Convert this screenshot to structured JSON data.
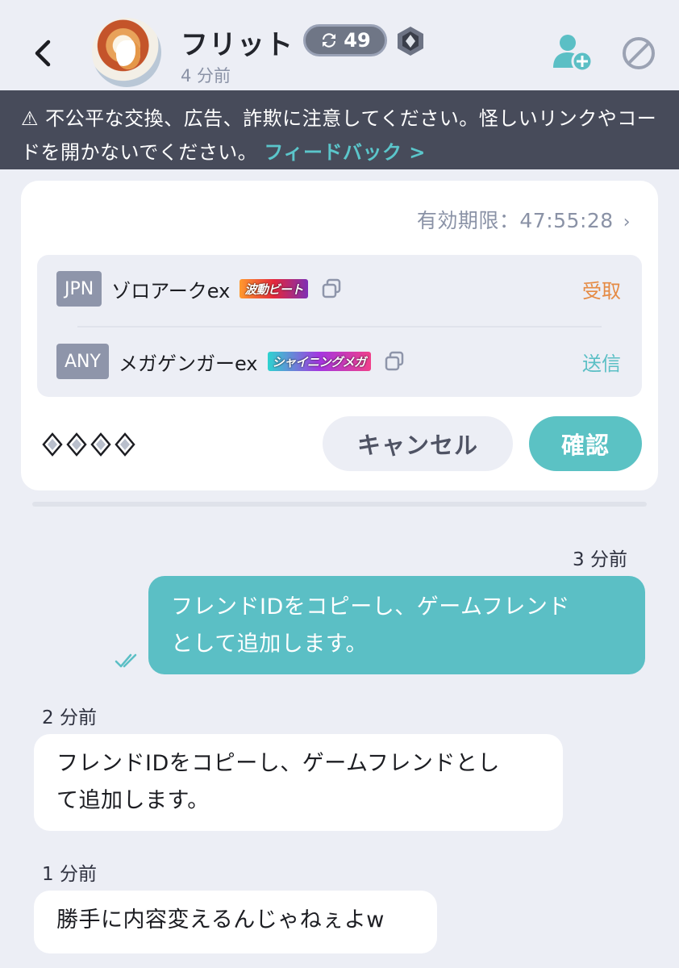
{
  "header": {
    "back": "‹",
    "user_name": "フリット",
    "trade_count": "49",
    "last_seen": "4 分前"
  },
  "warning": {
    "icon": "⚠",
    "text": "不公平な交換、広告、詐欺に注意してください。怪しいリンクやコードを開かないでください。",
    "feedback_label": "フィードバック >"
  },
  "trade": {
    "expiry_label": "有効期限：47:55:28",
    "items": [
      {
        "lang": "JPN",
        "name": "ゾロアークex",
        "rarity_label": "波動ビート",
        "status": "受取",
        "status_color": "#e58a43"
      },
      {
        "lang": "ANY",
        "name": "メガゲンガーex",
        "rarity_label": "シャイニングメガ",
        "status": "送信",
        "status_color": "#5bbfc5"
      }
    ],
    "rarity_diamonds": 4,
    "cancel_label": "キャンセル",
    "confirm_label": "確認"
  },
  "chat": [
    {
      "time": "3 分前",
      "side": "out",
      "text": "フレンドIDをコピーし、ゲームフレンドとして追加します。",
      "lines": [
        "フレンドIDをコピーし、ゲームフレンド",
        "として追加します。"
      ],
      "read": true
    },
    {
      "time": "2 分前",
      "side": "in",
      "text": "フレンドIDをコピーし、ゲームフレンドとして追加します。",
      "lines": [
        "フレンドIDをコピーし、ゲームフレンドとし",
        "て追加します。"
      ]
    },
    {
      "time": "1 分前",
      "side": "in",
      "text": "勝手に内容変えるんじゃねぇよw",
      "lines": [
        "勝手に内容変えるんじゃねぇよw"
      ]
    }
  ],
  "colors": {
    "accent": "#5bbfc5",
    "banner_bg": "#474b5a",
    "page_bg": "#eceef5",
    "receive": "#e58a43"
  },
  "icons": [
    "back-icon",
    "avatar",
    "sync-icon",
    "rank-badge-icon",
    "add-friend-icon",
    "block-icon",
    "warning-icon",
    "chevron-right-icon",
    "copy-icon",
    "diamond-icon",
    "read-check-icon"
  ]
}
